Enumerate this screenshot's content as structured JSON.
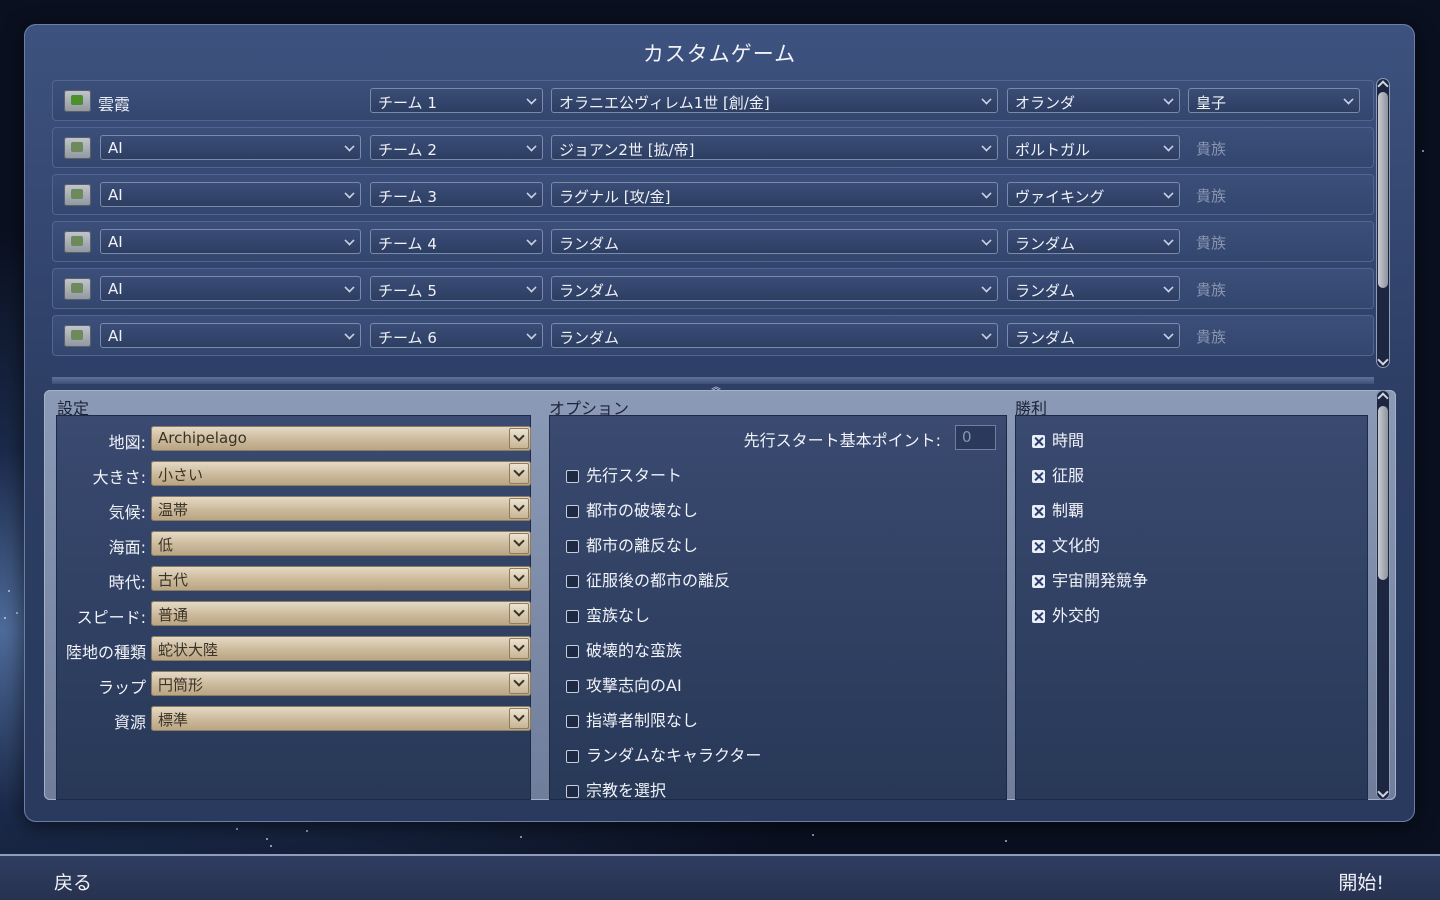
{
  "title": "カスタムゲーム",
  "players": [
    {
      "type": "human",
      "name": "雲霞",
      "team": "チーム 1",
      "leader": "オラニエ公ヴィレム1世 [創/金]",
      "civ": "オランダ",
      "level": "皇子",
      "level_editable": true
    },
    {
      "type": "ai",
      "name": "AI",
      "team": "チーム 2",
      "leader": "ジョアン2世 [拡/帝]",
      "civ": "ポルトガル",
      "level": "貴族",
      "level_editable": false
    },
    {
      "type": "ai",
      "name": "AI",
      "team": "チーム 3",
      "leader": "ラグナル [攻/金]",
      "civ": "ヴァイキング",
      "level": "貴族",
      "level_editable": false
    },
    {
      "type": "ai",
      "name": "AI",
      "team": "チーム 4",
      "leader": "ランダム",
      "civ": "ランダム",
      "level": "貴族",
      "level_editable": false
    },
    {
      "type": "ai",
      "name": "AI",
      "team": "チーム 5",
      "leader": "ランダム",
      "civ": "ランダム",
      "level": "貴族",
      "level_editable": false
    },
    {
      "type": "ai",
      "name": "AI",
      "team": "チーム 6",
      "leader": "ランダム",
      "civ": "ランダム",
      "level": "貴族",
      "level_editable": false
    }
  ],
  "settings": {
    "title": "設定",
    "items": [
      {
        "label": "地図:",
        "value": "Archipelago"
      },
      {
        "label": "大きさ:",
        "value": "小さい"
      },
      {
        "label": "気候:",
        "value": "温帯"
      },
      {
        "label": "海面:",
        "value": "低"
      },
      {
        "label": "時代:",
        "value": "古代"
      },
      {
        "label": "スピード:",
        "value": "普通"
      },
      {
        "label": "陸地の種類",
        "value": "蛇状大陸"
      },
      {
        "label": "ラップ",
        "value": "円筒形"
      },
      {
        "label": "資源",
        "value": "標準"
      }
    ]
  },
  "options": {
    "title": "オプション",
    "points_label": "先行スタート基本ポイント:",
    "points_value": "0",
    "items": [
      {
        "label": "先行スタート",
        "checked": false
      },
      {
        "label": "都市の破壊なし",
        "checked": false
      },
      {
        "label": "都市の離反なし",
        "checked": false
      },
      {
        "label": "征服後の都市の離反",
        "checked": false
      },
      {
        "label": "蛮族なし",
        "checked": false
      },
      {
        "label": "破壊的な蛮族",
        "checked": false
      },
      {
        "label": "攻撃志向のAI",
        "checked": false
      },
      {
        "label": "指導者制限なし",
        "checked": false
      },
      {
        "label": "ランダムなキャラクター",
        "checked": false
      },
      {
        "label": "宗教を選択",
        "checked": false
      }
    ]
  },
  "victory": {
    "title": "勝利",
    "items": [
      {
        "label": "時間",
        "checked": true
      },
      {
        "label": "征服",
        "checked": true
      },
      {
        "label": "制覇",
        "checked": true
      },
      {
        "label": "文化的",
        "checked": true
      },
      {
        "label": "宇宙開発競争",
        "checked": true
      },
      {
        "label": "外交的",
        "checked": true
      }
    ]
  },
  "footer": {
    "back_label": "戻る",
    "start_label": "開始!"
  }
}
